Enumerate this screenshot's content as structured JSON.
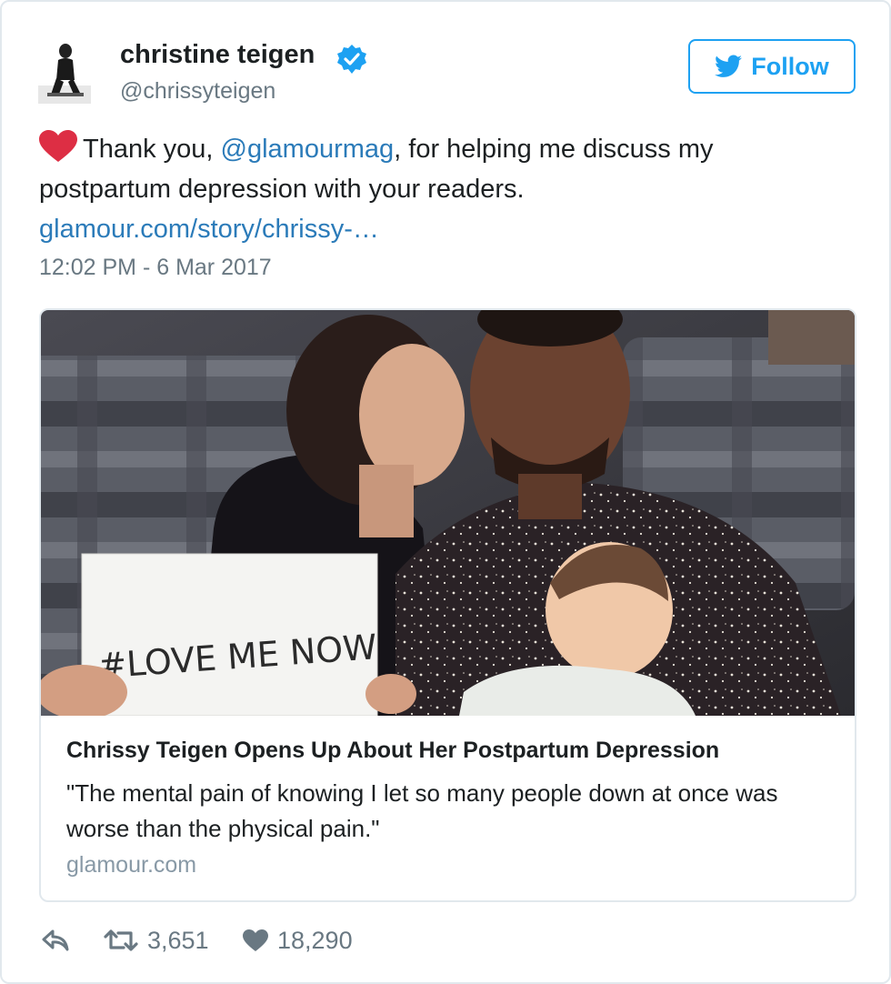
{
  "author": {
    "name": "christine teigen",
    "handle": "@chrissyteigen",
    "verified": true
  },
  "follow_button": {
    "label": "Follow",
    "icon": "twitter-bird-icon"
  },
  "tweet": {
    "text_before": "Thank you, ",
    "mention": "@glamourmag",
    "text_after": ", for helping me discuss my postpartum depression with your readers.",
    "link": "glamour.com/story/chrissy-…",
    "timestamp": "12:02 PM - 6 Mar 2017"
  },
  "card": {
    "sign_text": "#LOVE ME NOW",
    "title": "Chrissy Teigen Opens Up About Her Postpartum Depression",
    "description": "\"The mental pain of knowing I let so many people down at once was worse than the physical pain.\"",
    "domain": "glamour.com"
  },
  "actions": {
    "retweets": "3,651",
    "likes": "18,290"
  },
  "colors": {
    "accent": "#1da1f2",
    "link": "#2b7bb9",
    "muted": "#697882",
    "heart": "#e0245e"
  }
}
